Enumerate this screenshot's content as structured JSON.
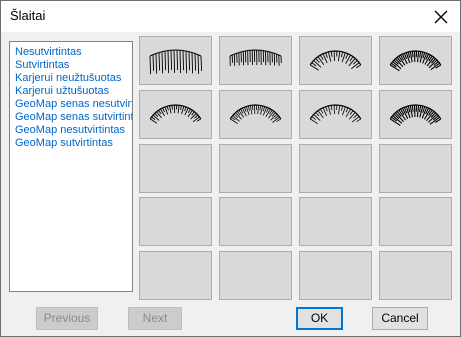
{
  "dialog": {
    "title": "Šlaitai"
  },
  "styles_list": {
    "items": [
      "Nesutvirtintas",
      "Sutvirtintas",
      "Karjerui neužtušuotas",
      "Karjerui užtušuotas",
      "GeoMap senas nesutvirtintas",
      "GeoMap senas sutvirtintas",
      "GeoMap nesutvirtintas",
      "GeoMap sutvirtintas"
    ]
  },
  "preview_grid": {
    "rows": 5,
    "cols": 4,
    "tiles": [
      {
        "index": 0,
        "pattern": "straight-long-hatch"
      },
      {
        "index": 1,
        "pattern": "straight-dense-hatch"
      },
      {
        "index": 2,
        "pattern": "curved-hatch-sparse"
      },
      {
        "index": 3,
        "pattern": "curved-hatch-dense"
      },
      {
        "index": 4,
        "pattern": "curved-hatch-short"
      },
      {
        "index": 5,
        "pattern": "curved-hatch-fine"
      },
      {
        "index": 6,
        "pattern": "curved-hatch-open"
      },
      {
        "index": 7,
        "pattern": "curved-hatch-heavy"
      }
    ]
  },
  "buttons": {
    "previous": "Previous",
    "next": "Next",
    "ok": "OK",
    "cancel": "Cancel"
  },
  "icons": {
    "close": "close-icon"
  }
}
